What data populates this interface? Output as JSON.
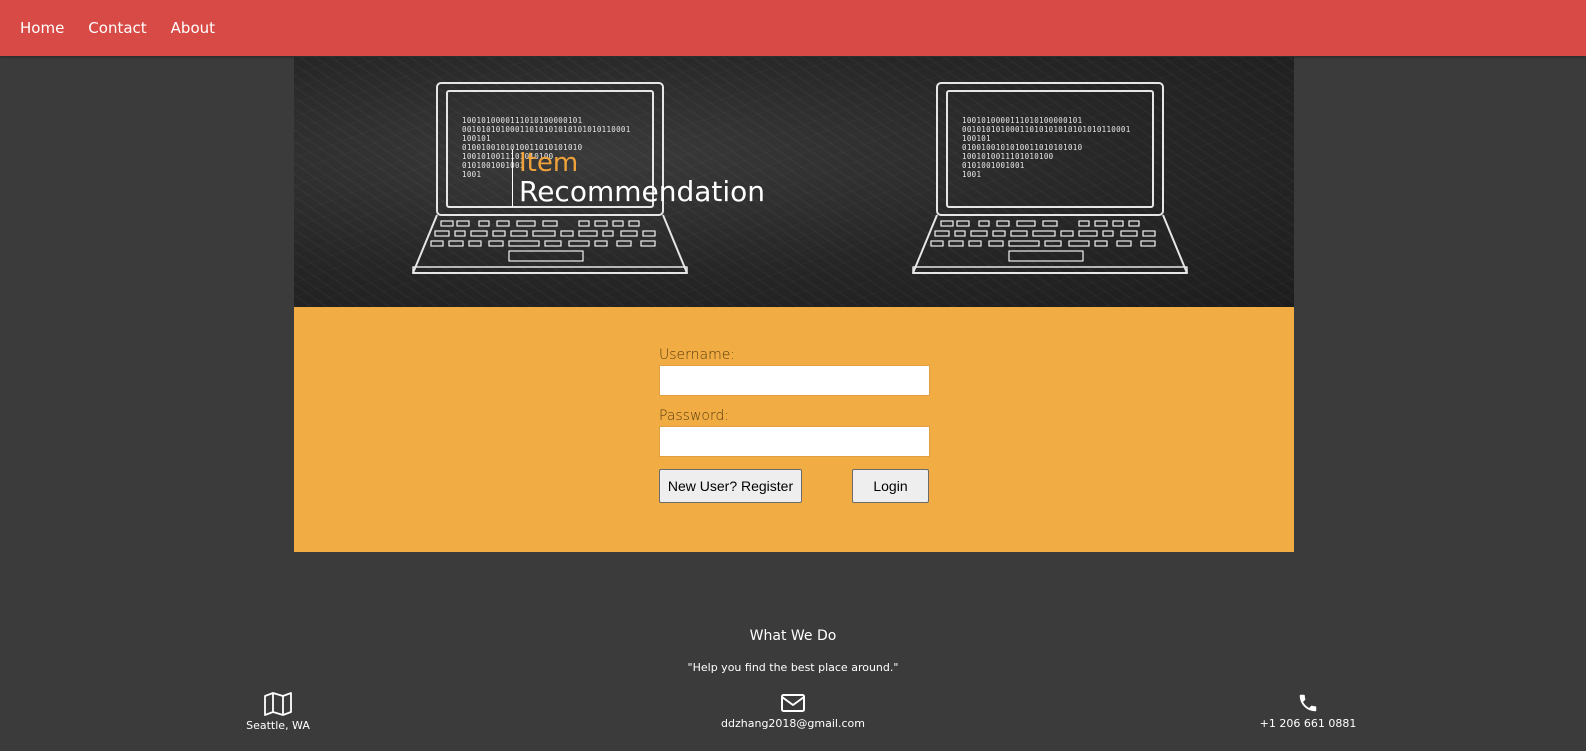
{
  "nav": {
    "items": [
      {
        "label": "Home"
      },
      {
        "label": "Contact"
      },
      {
        "label": "About"
      }
    ]
  },
  "banner": {
    "title_line1": "Item",
    "title_line2": "Recommendation",
    "binary_text": "1001010000111010100000101\n00101010100011010101010101010110001\n100101\n0100100101010011010101010\n1001010011101010100\n0101001001001\n1001"
  },
  "login": {
    "username_label": "Username:",
    "username_value": "",
    "password_label": "Password:",
    "password_value": "",
    "register_label": "New User? Register",
    "login_label": "Login"
  },
  "footer": {
    "heading": "What We Do",
    "tagline": "\"Help you find the best place around.\"",
    "location": "Seattle, WA",
    "email": "ddzhang2018@gmail.com",
    "phone": "+1 206 661 0881"
  },
  "icons": {
    "location": "map-icon",
    "email": "envelope-icon",
    "phone": "phone-icon"
  },
  "colors": {
    "nav_bg": "#d84a45",
    "accent_orange": "#f1ad44",
    "title_orange": "#f0a23a",
    "page_bg": "#3b3b3b"
  }
}
